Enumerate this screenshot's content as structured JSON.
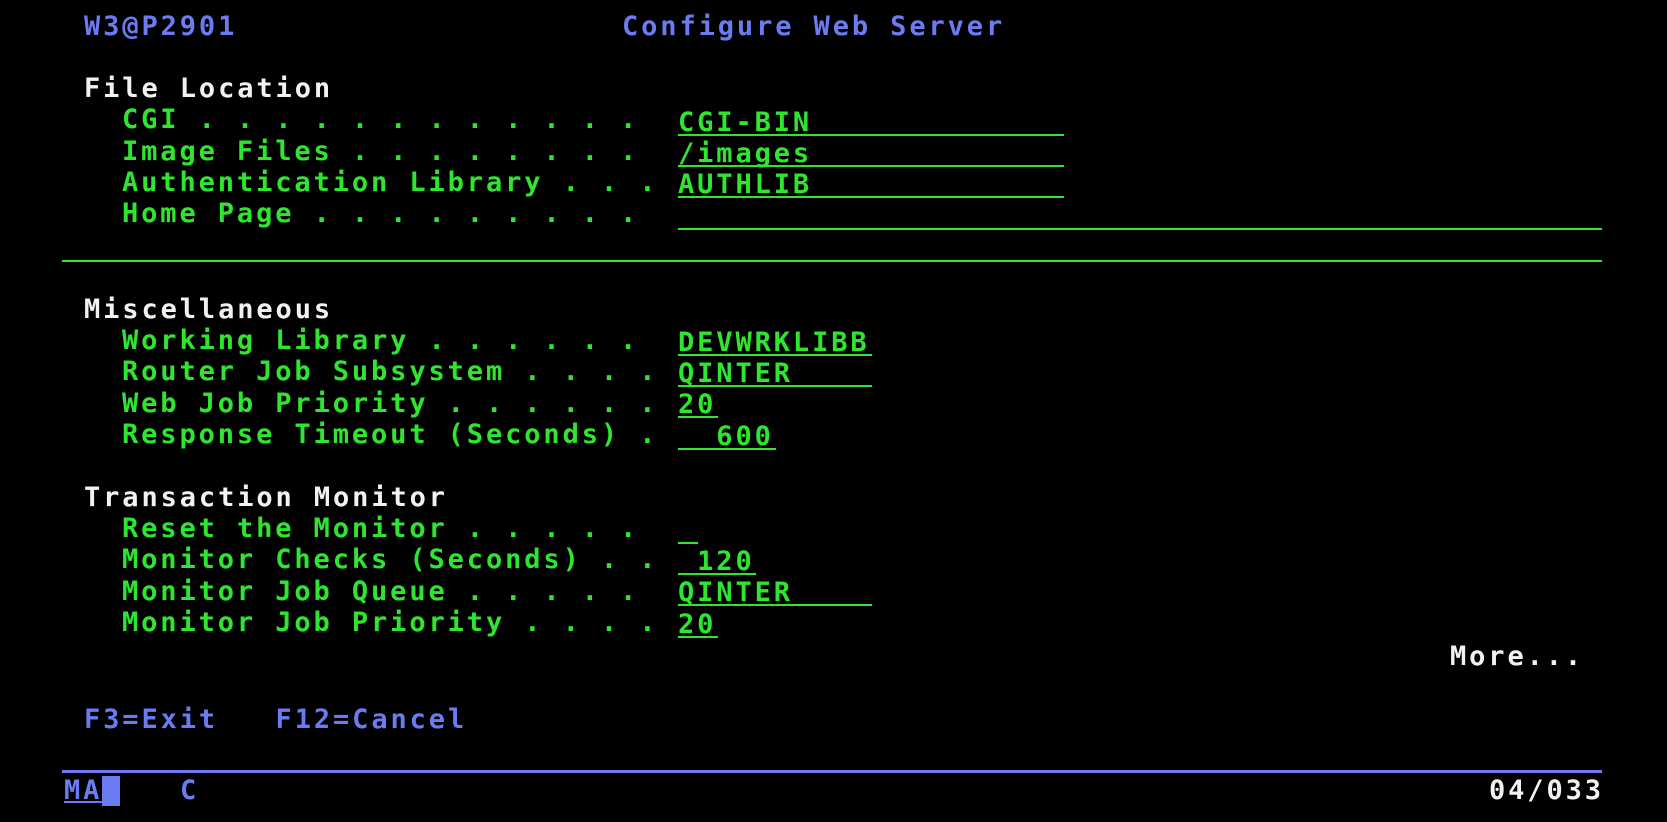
{
  "header": {
    "program_id": "W3@P2901",
    "title": "Configure Web Server"
  },
  "sections": {
    "file_location": {
      "heading": "File Location",
      "rows": [
        {
          "label": "CGI . . . . . . . . . . . .",
          "value": "CGI-BIN"
        },
        {
          "label": "Image Files . . . . . . . .",
          "value": "/images"
        },
        {
          "label": "Authentication Library . . .",
          "value": "AUTHLIB"
        },
        {
          "label": "Home Page . . . . . . . . .",
          "value": ""
        }
      ]
    },
    "miscellaneous": {
      "heading": "Miscellaneous",
      "rows": [
        {
          "label": "Working Library . . . . . .",
          "value": "DEVWRKLIBB"
        },
        {
          "label": "Router Job Subsystem . . . .",
          "value": "QINTER"
        },
        {
          "label": "Web Job Priority . . . . . .",
          "value": "20"
        },
        {
          "label": "Response Timeout (Seconds) .",
          "value": "  600"
        }
      ]
    },
    "transaction_monitor": {
      "heading": "Transaction Monitor",
      "rows": [
        {
          "label": "Reset the Monitor . . . . .",
          "value": ""
        },
        {
          "label": "Monitor Checks (Seconds) . .",
          "value": " 120"
        },
        {
          "label": "Monitor Job Queue . . . . .",
          "value": "QINTER"
        },
        {
          "label": "Monitor Job Priority . . . .",
          "value": "20"
        }
      ]
    }
  },
  "more_indicator": "More...",
  "function_keys": "F3=Exit   F12=Cancel",
  "status_bar": {
    "session_indicator": "MA",
    "mode_indicator": "C",
    "cursor_position": "04/033"
  },
  "colors": {
    "background": "#000000",
    "input_field": "#2fe62f",
    "heading": "#f2f2f2",
    "system_text": "#6b7cf2"
  }
}
